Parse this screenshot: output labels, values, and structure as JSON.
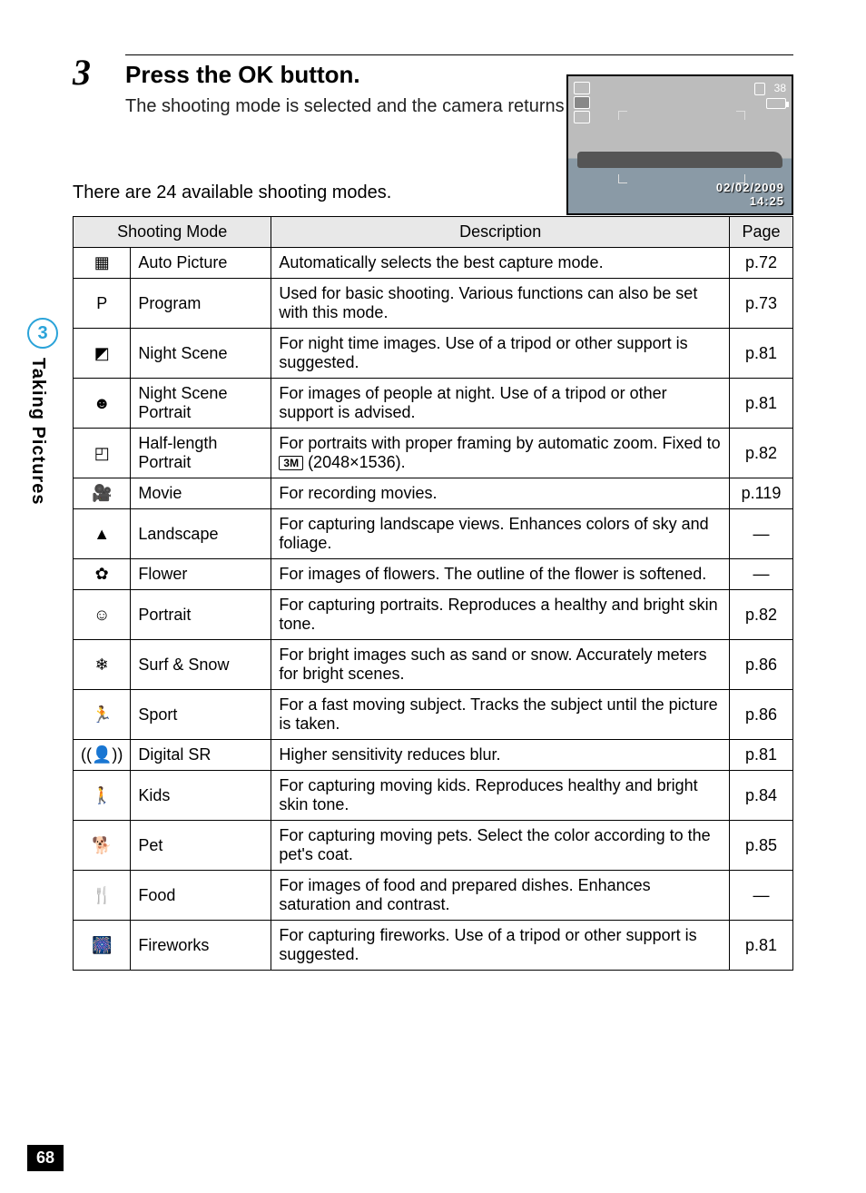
{
  "side": {
    "chapter_num": "3",
    "chapter_title": "Taking Pictures"
  },
  "step": {
    "number": "3",
    "title_pre": "Press the ",
    "title_btn": "OK",
    "title_post": " button.",
    "desc": "The shooting mode is selected and the camera returns to capture status."
  },
  "preview": {
    "shots_remaining": "38",
    "date": "02/02/2009",
    "time": "14:25"
  },
  "intro": "There are 24 available shooting modes.",
  "headers": {
    "mode": "Shooting Mode",
    "desc": "Description",
    "page": "Page"
  },
  "half_length_desc_pre": "For portraits with proper framing by automatic zoom. Fixed to ",
  "half_length_badge": "3M",
  "half_length_desc_post": " (2048×1536).",
  "rows": [
    {
      "icon": "▦",
      "icon_name": "auto-pict-icon",
      "name": "Auto Picture",
      "desc": "Automatically selects the best capture mode.",
      "page": "p.72"
    },
    {
      "icon": "P",
      "icon_name": "program-icon",
      "name": "Program",
      "desc": "Used for basic shooting. Various functions can also be set with this mode.",
      "page": "p.73"
    },
    {
      "icon": "◩",
      "icon_name": "night-scene-icon",
      "name": "Night Scene",
      "desc": "For night time images. Use of a tripod or other support is suggested.",
      "page": "p.81"
    },
    {
      "icon": "☻",
      "icon_name": "night-portrait-icon",
      "name": "Night Scene Portrait",
      "desc": "For images of people at night. Use of a tripod or other support is advised.",
      "page": "p.81"
    },
    {
      "icon": "◰",
      "icon_name": "half-length-icon",
      "name": "Half-length Portrait",
      "desc": "__HALF_LENGTH__",
      "page": "p.82"
    },
    {
      "icon": "🎥",
      "icon_name": "movie-icon",
      "name": "Movie",
      "desc": "For recording movies.",
      "page": "p.119"
    },
    {
      "icon": "▲",
      "icon_name": "landscape-icon",
      "name": "Landscape",
      "desc": "For capturing landscape views. Enhances colors of sky and foliage.",
      "page": "—"
    },
    {
      "icon": "✿",
      "icon_name": "flower-icon",
      "name": "Flower",
      "desc": "For images of flowers. The outline of the flower is softened.",
      "page": "—"
    },
    {
      "icon": "☺",
      "icon_name": "portrait-icon",
      "name": "Portrait",
      "desc": "For capturing portraits. Reproduces a healthy and bright skin tone.",
      "page": "p.82"
    },
    {
      "icon": "❄",
      "icon_name": "surf-snow-icon",
      "name": "Surf & Snow",
      "desc": "For bright images such as sand or snow. Accurately meters for bright scenes.",
      "page": "p.86"
    },
    {
      "icon": "🏃",
      "icon_name": "sport-icon",
      "name": "Sport",
      "desc": "For a fast moving subject. Tracks the subject until the picture is taken.",
      "page": "p.86"
    },
    {
      "icon": "((👤))",
      "icon_name": "digital-sr-icon",
      "name": "Digital SR",
      "desc": "Higher sensitivity reduces blur.",
      "page": "p.81"
    },
    {
      "icon": "🚶",
      "icon_name": "kids-icon",
      "name": "Kids",
      "desc": "For capturing moving kids. Reproduces healthy and bright skin tone.",
      "page": "p.84"
    },
    {
      "icon": "🐕",
      "icon_name": "pet-icon",
      "name": "Pet",
      "desc": "For capturing moving pets. Select the color according to the pet's coat.",
      "page": "p.85"
    },
    {
      "icon": "🍴",
      "icon_name": "food-icon",
      "name": "Food",
      "desc": "For images of food and prepared dishes. Enhances saturation and contrast.",
      "page": "—"
    },
    {
      "icon": "🎆",
      "icon_name": "fireworks-icon",
      "name": "Fireworks",
      "desc": "For capturing fireworks. Use of a tripod or other support is suggested.",
      "page": "p.81"
    }
  ],
  "page_number": "68"
}
